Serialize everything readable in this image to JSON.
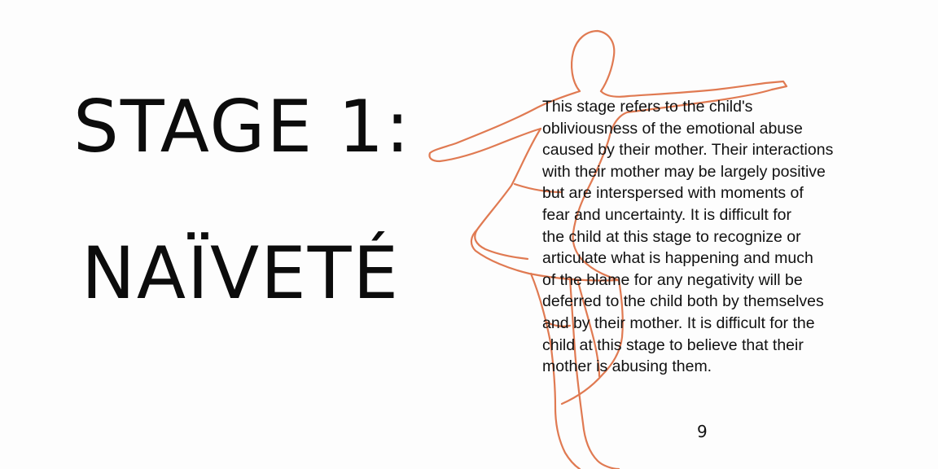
{
  "slide": {
    "title_line_1": "STAGE 1:",
    "title_line_2": "NAÏVETÉ",
    "body": "This stage refers to the child's\nobliviousness of the emotional abuse\ncaused by their mother. Their interactions\nwith their mother may be largely positive\nbut are interspersed with moments of\nfear and uncertainty. It is difficult for\nthe child at this stage to recognize or\narticulate what is happening and much\nof the blame for any negativity will be\ndeferred to the child both by themselves\nand by their mother. It is difficult for the\nchild at this stage to believe that their\nmother is abusing them.",
    "page_number": "9"
  },
  "colors": {
    "figure_outline": "#e07a52",
    "text": "#111111",
    "background": "#fdfdfd"
  },
  "icons": {
    "figure": "child-figure-outline"
  }
}
